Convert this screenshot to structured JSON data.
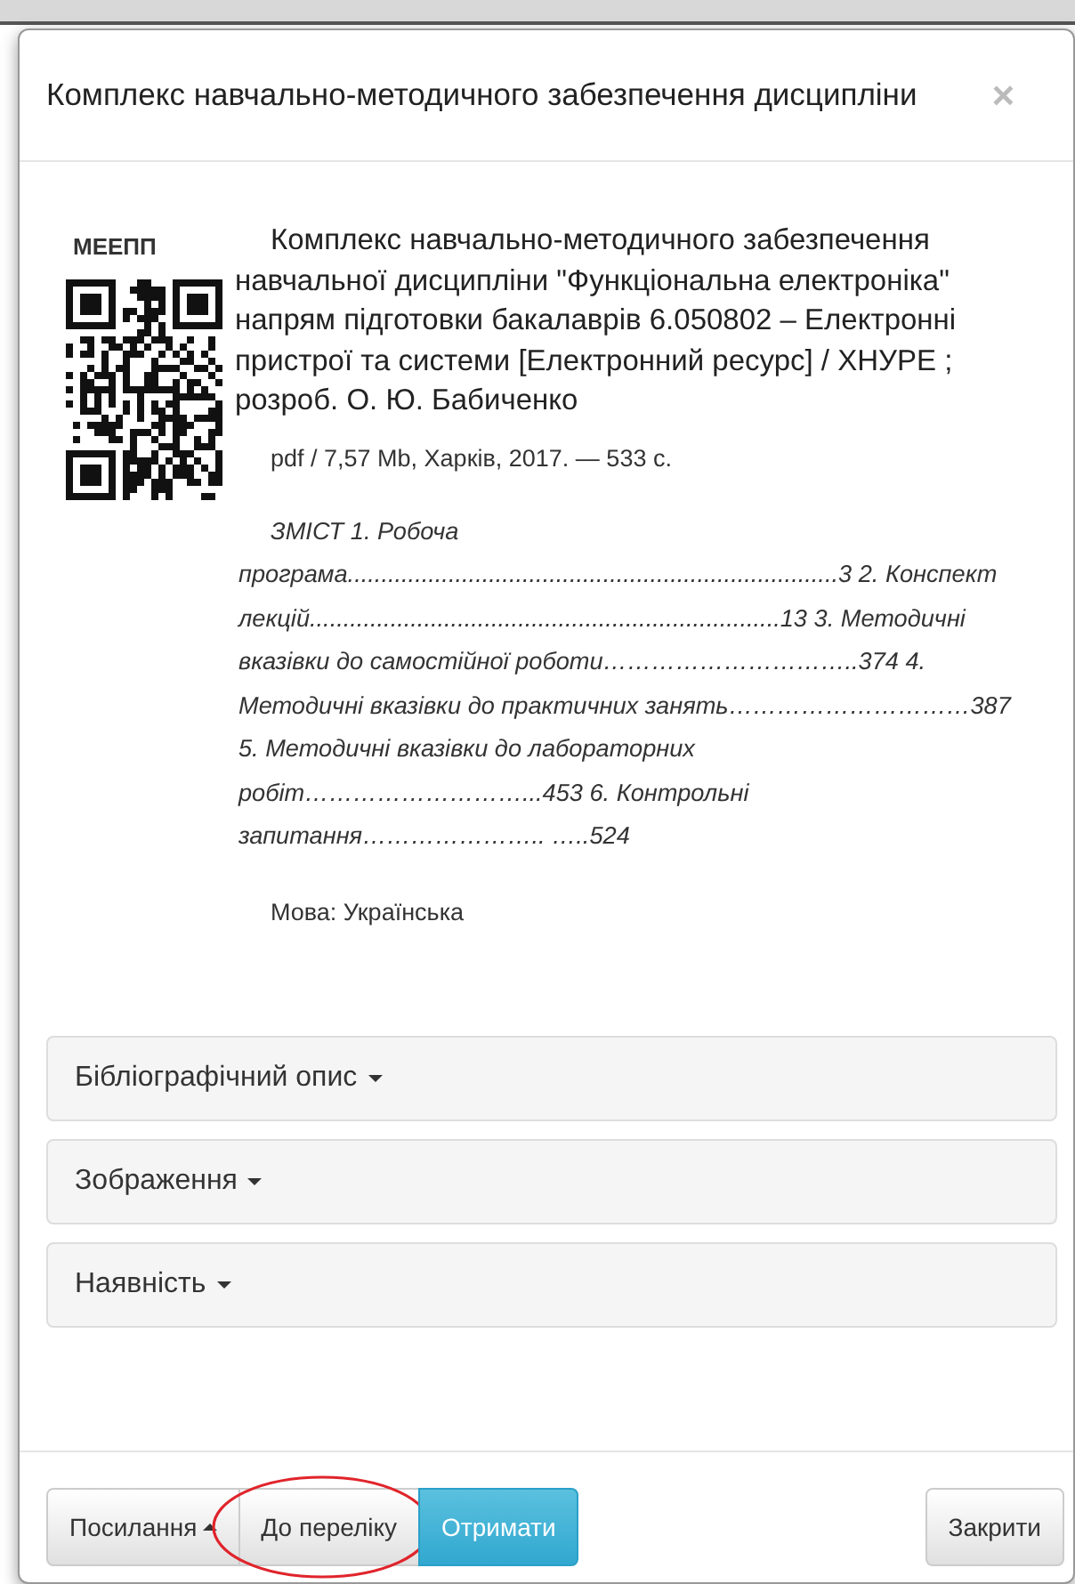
{
  "dialog": {
    "title": "Комплекс навчально-методичного забезпечення дисципліни",
    "close": "×"
  },
  "record": {
    "code": "МЕЕПП",
    "title": "Комплекс навчально-методичного забезпечення навчальної дисципліни \"Функціональна електроніка\" напрям підготовки бакалаврів 6.050802 – Електронні пристрої та системи [Електронний ресурс] / ХНУРЕ ; розроб. О. Ю. Бабиченко",
    "details": "pdf / 7,57 Mb, Харків, 2017. — 533 с.",
    "contents": "ЗМІСТ 1. Робоча програма.........................................................................3 2. Конспект лекцій......................................................................13 3. Методичні вказівки до самостійної роботи…………………………..374 4. Методичні вказівки до практичних занять…………………………387 5. Методичні вказівки до лабораторних робіт………………………...453 6. Контрольні запитання………………….. …..524",
    "language": "Мова: Українська"
  },
  "sections": [
    {
      "label": "Бібліографічний опис",
      "expanded": false
    },
    {
      "label": "Зображення",
      "expanded": false
    },
    {
      "label": "Наявність",
      "expanded": false
    }
  ],
  "buttons": [
    {
      "label": "Посилання",
      "kind": "dropup",
      "highlighted": false
    },
    {
      "label": "До переліку",
      "kind": "default",
      "highlighted": true
    },
    {
      "label": "Отримати",
      "kind": "primary",
      "highlighted": false
    }
  ],
  "close_button": "Закрити"
}
